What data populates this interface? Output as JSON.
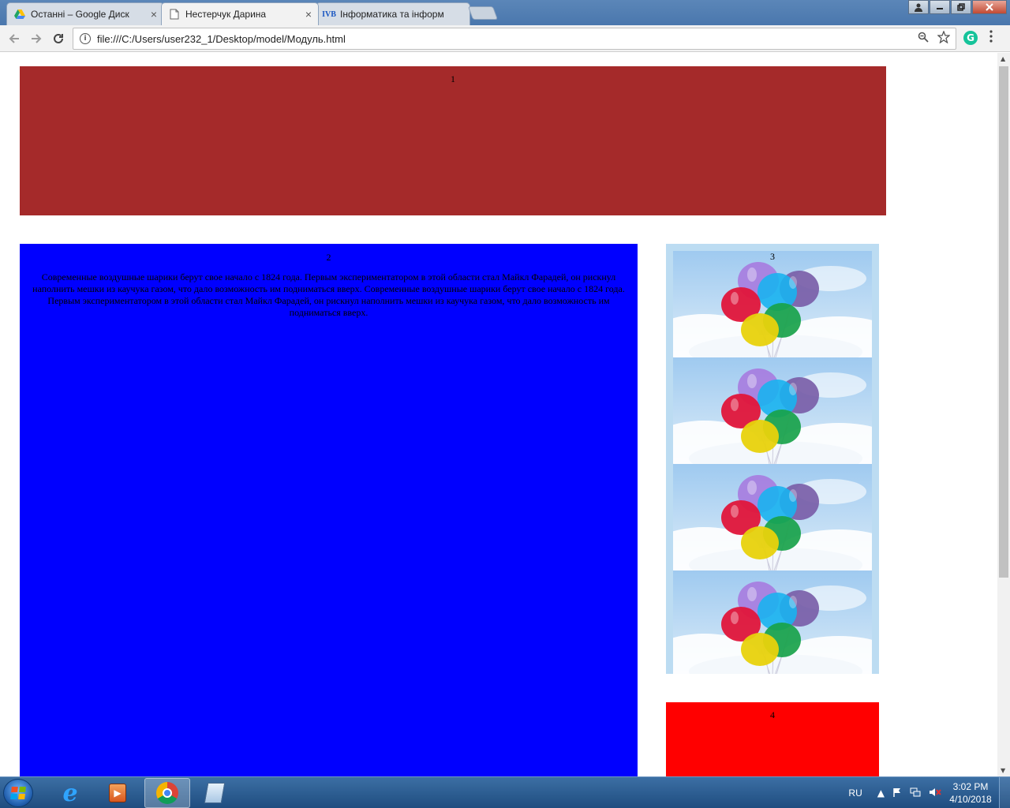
{
  "browser": {
    "tabs": [
      {
        "title": "Останні – Google Диск",
        "icon": "google-drive-icon",
        "active": false
      },
      {
        "title": "Нестерчук Дарина",
        "icon": "page-icon",
        "active": true
      },
      {
        "title": "Інформатика та інформ",
        "icon": "site-logo-icon",
        "active": false
      }
    ],
    "close_glyph": "×",
    "address": "file:///C:/Users/user232_1/Desktop/model/Модуль.html",
    "extension_label": "G"
  },
  "page": {
    "block1_label": "1",
    "block2_label": "2",
    "block2_text": "Современные воздушные шарики берут свое начало с 1824 года. Первым экспериментатором в этой области стал Майкл Фарадей, он рискнул наполнить мешки из каучука газом, что дало возможность им подниматься вверх. Современные воздушные шарики берут свое начало с 1824 года. Первым экспериментатором в этой области стал Майкл Фарадей, он рискнул наполнить мешки из каучука газом, что дало возможность им подниматься вверх.",
    "block3_label": "3",
    "block4_label": "4",
    "colors": {
      "block1": "#a52a2a",
      "block2": "#0000ff",
      "block4": "#ff0000"
    },
    "image_tiles": 4
  },
  "taskbar": {
    "language": "RU",
    "time": "3:02 PM",
    "date": "4/10/2018",
    "pinned": [
      "internet-explorer-icon",
      "media-player-icon",
      "chrome-icon",
      "notepad-icon"
    ]
  }
}
